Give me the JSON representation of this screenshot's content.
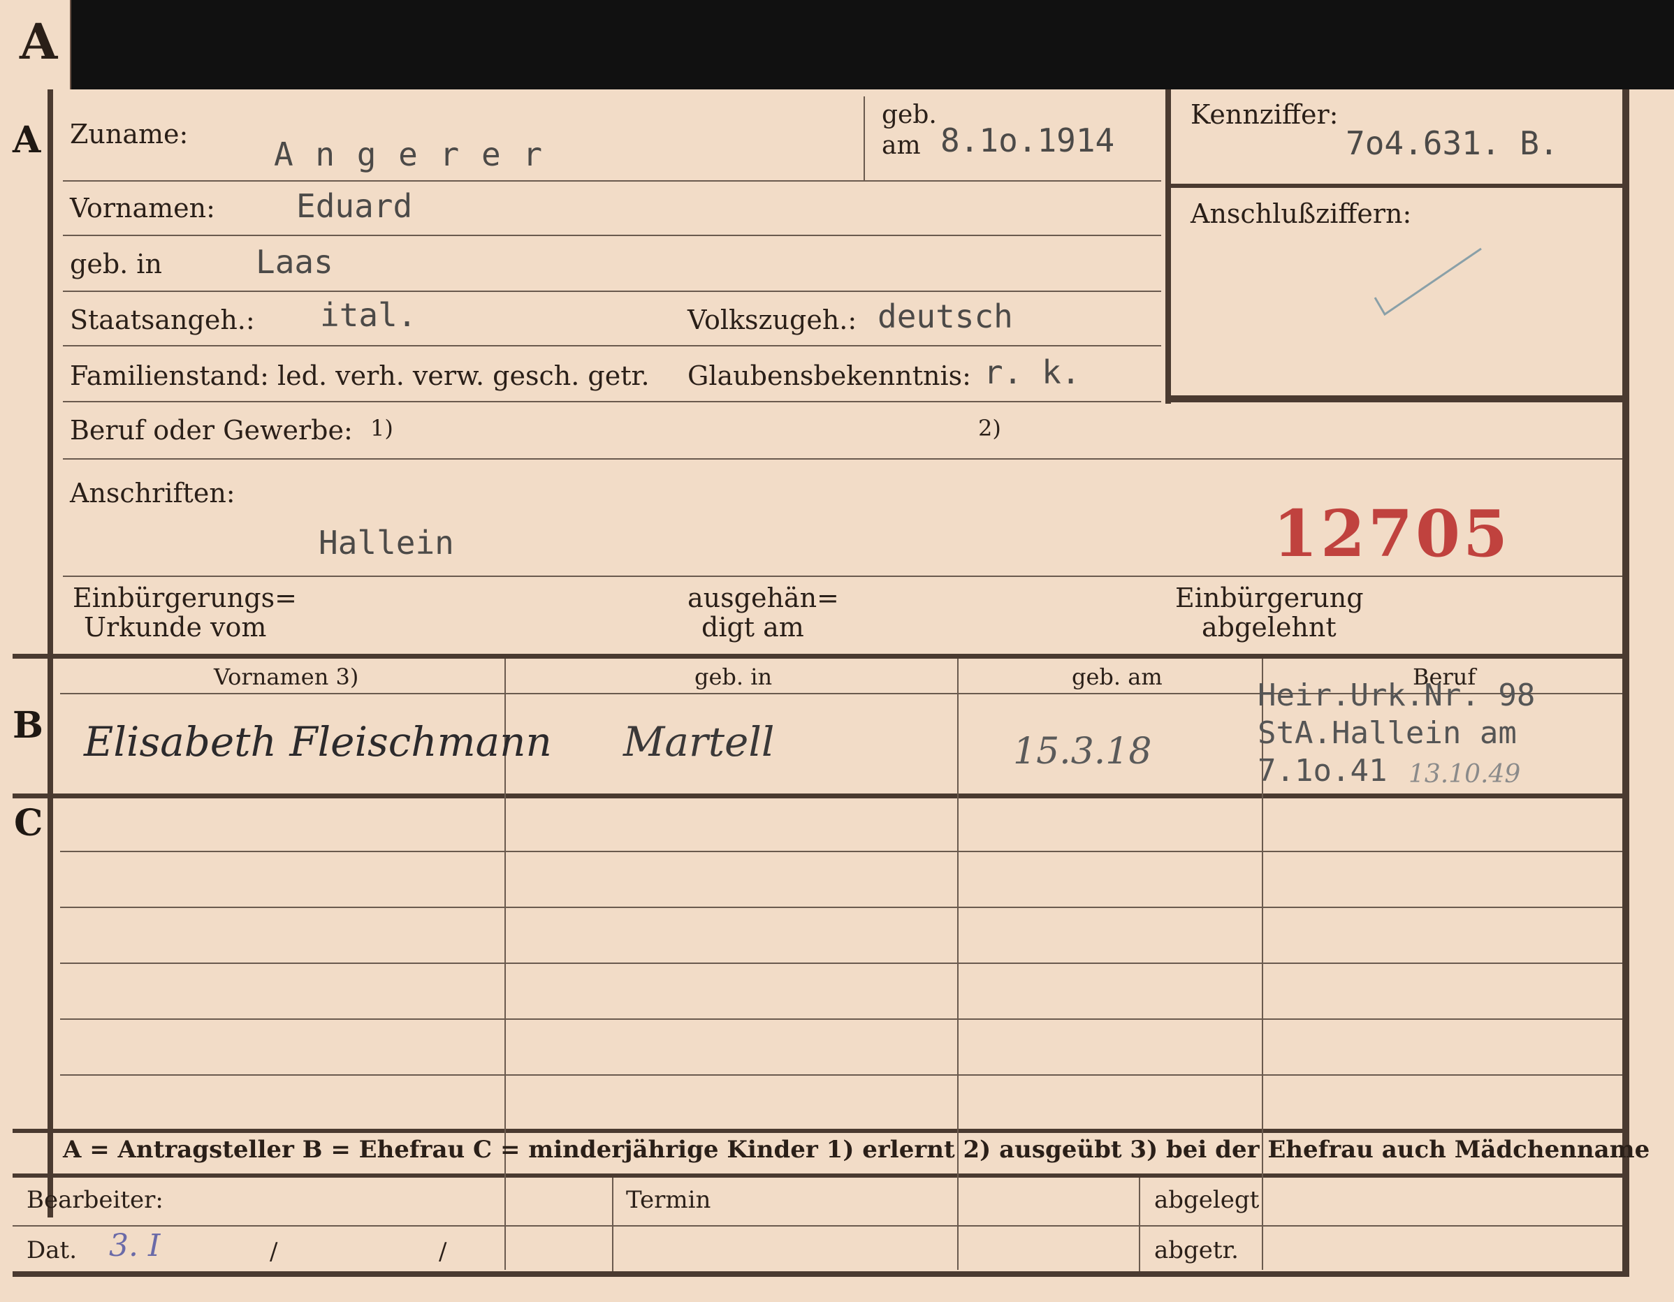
{
  "tab": {
    "letter": "A"
  },
  "sections": {
    "a": "A",
    "b": "B",
    "c": "C"
  },
  "applicant": {
    "surname_label": "Zuname:",
    "surname": "A n g e r e r",
    "geb_label": "geb.",
    "am_label": "am",
    "birth_date": "8.1o.1914",
    "given_names_label": "Vornamen:",
    "given_names": "Eduard",
    "born_in_label": "geb. in",
    "born_in": "Laas",
    "citizenship_label": "Staatsangeh.:",
    "citizenship": "ital.",
    "ethnicity_label": "Volkszugeh.:",
    "ethnicity": "deutsch",
    "marital_label": "Familienstand: led. verh. verw. gesch. getr.",
    "religion_label": "Glaubensbekenntnis:",
    "religion": "r. k.",
    "occupation_label": "Beruf oder Gewerbe:",
    "fn1": "1)",
    "fn2": "2)",
    "address_label": "Anschriften:",
    "address": "Hallein",
    "stamp_number": "12705",
    "naturalization_label_1": "Einbürgerungs=",
    "naturalization_label_2": "Urkunde vom",
    "handed_label_1": "ausgehän=",
    "handed_label_2": "digt am",
    "refused_label_1": "Einbürgerung",
    "refused_label_2": "abgelehnt"
  },
  "id_box": {
    "kennziffer_label": "Kennziffer:",
    "kennziffer": "7o4.631. B.",
    "anschluss_label": "Anschlußziffern:"
  },
  "table": {
    "headers": [
      "Vornamen 3)",
      "geb. in",
      "geb. am",
      "Beruf"
    ],
    "wife": {
      "name": "Elisabeth Fleischmann",
      "place": "Martell",
      "date": "15.3.18",
      "note_line1": "Heir.Urk.Nr. 98",
      "note_line2": "StA.Hallein am",
      "note_line3": "7.1o.41",
      "note_hand": "13.10.49"
    }
  },
  "legend": {
    "text": "A = Antragsteller   B = Ehefrau   C = minderjährige Kinder   1) erlernt   2) ausgeübt   3) bei der Ehefrau auch Mädchenname"
  },
  "footer": {
    "clerk_label": "Bearbeiter:",
    "date_label": "Dat.",
    "date_value": "3. I",
    "slash": "/",
    "termin_label": "Termin",
    "filed_label": "abgelegt",
    "removed_label": "abgetr."
  },
  "colors": {
    "card": "#f2dcc7",
    "ink": "#2a1f18",
    "stamp": "#c0423e",
    "pencil": "#6a6aa8"
  }
}
